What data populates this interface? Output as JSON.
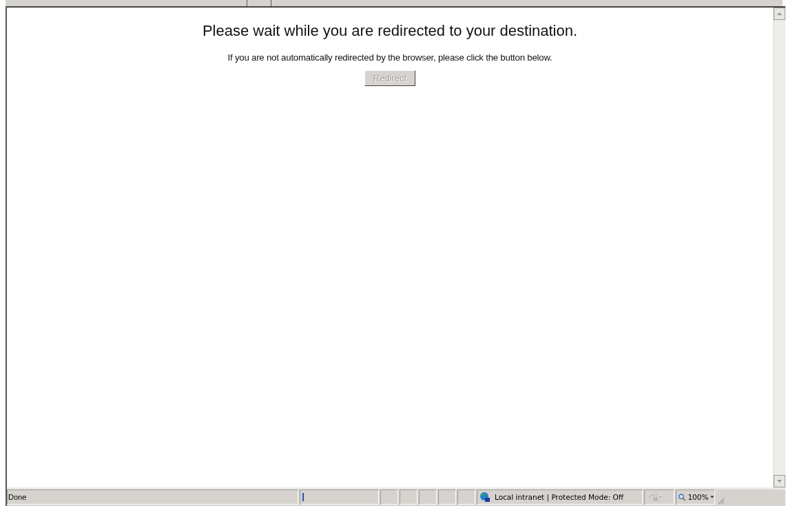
{
  "page": {
    "heading": "Please wait while you are redirected to your destination.",
    "message": "If you are not automatically redirected by the browser, please click the button below.",
    "button": {
      "label": "Redirect",
      "disabled": true
    }
  },
  "status_bar": {
    "status": "Done",
    "zone": "Local intranet | Protected Mode: Off",
    "zoom": "100%"
  }
}
